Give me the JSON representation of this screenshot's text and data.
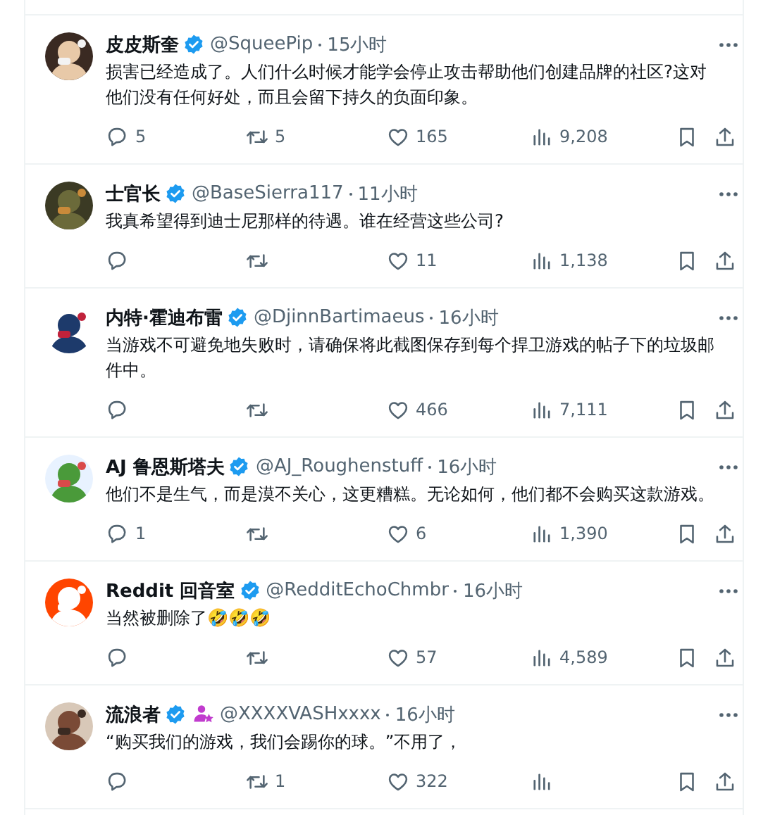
{
  "tweets": [
    {
      "name": "皮皮斯奎",
      "verified": true,
      "affiliated": false,
      "handle": "@SqueePip",
      "time": "15小时",
      "text": "损害已经造成了。人们什么时候才能学会停止攻击帮助他们创建品牌的社区?这对他们没有任何好处，而且会留下持久的负面印象。",
      "replies": "5",
      "reposts": "5",
      "likes": "165",
      "views": "9,208"
    },
    {
      "name": "士官长",
      "verified": true,
      "affiliated": false,
      "handle": "@BaseSierra117",
      "time": "11小时",
      "text": "我真希望得到迪士尼那样的待遇。谁在经营这些公司?",
      "likes": "11",
      "views": "1,138"
    },
    {
      "name": "内特·霍迪布雷",
      "verified": true,
      "affiliated": false,
      "handle": "@DjinnBartimaeus",
      "time": "16小时",
      "text": "当游戏不可避免地失败时，请确保将此截图保存到每个捍卫游戏的帖子下的垃圾邮件中。",
      "likes": "466",
      "views": "7,111"
    },
    {
      "name": "AJ 鲁恩斯塔夫",
      "verified": true,
      "affiliated": false,
      "handle": "@AJ_Roughenstuff",
      "time": "16小时",
      "text": "他们不是生气，而是漠不关心，这更糟糕。无论如何，他们都不会购买这款游戏。",
      "replies": "1",
      "likes": "6",
      "views": "1,390"
    },
    {
      "name": "Reddit 回音室",
      "verified": true,
      "affiliated": false,
      "handle": "@RedditEchoChmbr",
      "time": "16小时",
      "text": "当然被删除了🤣🤣🤣",
      "likes": "57",
      "views": "4,589"
    },
    {
      "name": "流浪者",
      "verified": true,
      "affiliated": true,
      "handle": "@XXXXVASHxxxx",
      "time": "16小时",
      "text": "“购买我们的游戏，我们会踢你的球。”不用了，",
      "reposts": "1",
      "likes": "322"
    }
  ]
}
